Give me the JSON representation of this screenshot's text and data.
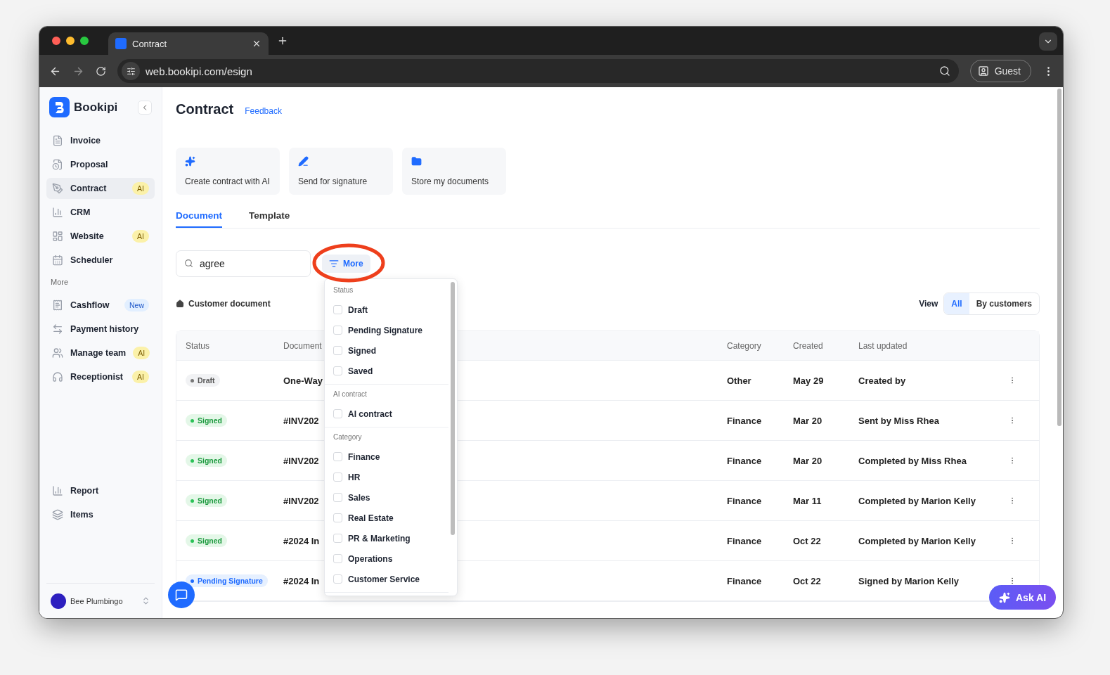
{
  "browser": {
    "tab_title": "Contract",
    "url": "web.bookipi.com/esign",
    "profile": "Guest"
  },
  "sidebar": {
    "brand": "Bookipi",
    "items": [
      {
        "label": "Invoice",
        "selected": false
      },
      {
        "label": "Proposal",
        "selected": false
      },
      {
        "label": "Contract",
        "selected": true,
        "badge": {
          "text": "AI",
          "kind": "ai"
        }
      },
      {
        "label": "CRM",
        "selected": false
      },
      {
        "label": "Website",
        "selected": false,
        "badge": {
          "text": "AI",
          "kind": "ai"
        }
      },
      {
        "label": "Scheduler",
        "selected": false
      }
    ],
    "section": "More",
    "more_items": [
      {
        "label": "Cashflow",
        "selected": false,
        "badge": {
          "text": "New",
          "kind": "new"
        }
      },
      {
        "label": "Payment history",
        "selected": false
      },
      {
        "label": "Manage team",
        "selected": false,
        "badge": {
          "text": "AI",
          "kind": "ai"
        }
      },
      {
        "label": "Receptionist",
        "selected": false,
        "badge": {
          "text": "AI",
          "kind": "ai"
        }
      }
    ],
    "bottom_items": [
      {
        "label": "Report",
        "selected": false
      },
      {
        "label": "Items",
        "selected": false
      }
    ],
    "user": "Bee Plumbingo"
  },
  "page": {
    "title": "Contract",
    "feedback": "Feedback",
    "action_cards": [
      "Create contract with AI",
      "Send for signature",
      "Store my documents"
    ],
    "tabs": [
      {
        "label": "Document",
        "selected": true
      },
      {
        "label": "Template",
        "selected": false
      }
    ],
    "search": {
      "value": "agree"
    },
    "filter_button": "More",
    "section": "Customer document",
    "view": {
      "label": "View",
      "options": [
        {
          "label": "All",
          "selected": true
        },
        {
          "label": "By customers",
          "selected": false
        }
      ]
    }
  },
  "table": {
    "columns": [
      "Status",
      "Document",
      "Category",
      "Created",
      "Last updated"
    ],
    "rows": [
      {
        "status": "Draft",
        "kind": "draft",
        "document": "One-Way",
        "category": "Other",
        "created": "May 29",
        "last_updated": "Created by"
      },
      {
        "status": "Signed",
        "kind": "signed",
        "document": "#INV202",
        "category": "Finance",
        "created": "Mar 20",
        "last_updated": "Sent by Miss Rhea"
      },
      {
        "status": "Signed",
        "kind": "signed",
        "document": "#INV202",
        "category": "Finance",
        "created": "Mar 20",
        "last_updated": "Completed by Miss Rhea"
      },
      {
        "status": "Signed",
        "kind": "signed",
        "document": "#INV202",
        "category": "Finance",
        "created": "Mar 11",
        "last_updated": "Completed by Marion Kelly"
      },
      {
        "status": "Signed",
        "kind": "signed",
        "document": "#2024 In",
        "category": "Finance",
        "created": "Oct 22",
        "last_updated": "Completed by Marion Kelly"
      },
      {
        "status": "Pending Signature",
        "kind": "pending",
        "document": "#2024 In",
        "category": "Finance",
        "created": "Oct 22",
        "last_updated": "Signed by Marion Kelly"
      }
    ]
  },
  "filter_menu": {
    "groups": [
      {
        "title": "Status",
        "options": [
          {
            "label": "Draft",
            "checked": false
          },
          {
            "label": "Pending Signature",
            "checked": false
          },
          {
            "label": "Signed",
            "checked": false
          },
          {
            "label": "Saved",
            "checked": false
          }
        ]
      },
      {
        "title": "AI contract",
        "options": [
          {
            "label": "AI contract",
            "checked": false
          }
        ]
      },
      {
        "title": "Category",
        "options": [
          {
            "label": "Finance",
            "checked": false
          },
          {
            "label": "HR",
            "checked": false
          },
          {
            "label": "Sales",
            "checked": false
          },
          {
            "label": "Real Estate",
            "checked": false
          },
          {
            "label": "PR & Marketing",
            "checked": false
          },
          {
            "label": "Operations",
            "checked": false
          },
          {
            "label": "Customer Service",
            "checked": false
          }
        ]
      }
    ]
  },
  "ask_ai": "Ask AI"
}
